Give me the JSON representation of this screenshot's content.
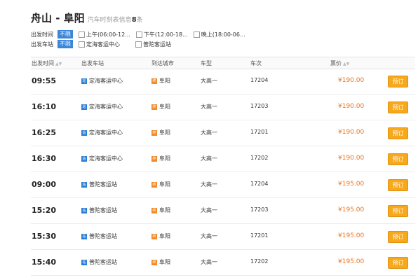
{
  "header": {
    "title": "舟山 - 阜阳",
    "subtitle_prefix": "汽车时刻表信息",
    "count": "8",
    "subtitle_suffix": "条"
  },
  "filters": {
    "time": {
      "label": "出发时间",
      "active": "不限",
      "options": [
        "上午(06:00-12...",
        "下午(12:00-18...",
        "晚上(18:00-06..."
      ]
    },
    "station": {
      "label": "出发车站",
      "active": "不限",
      "options": [
        "定海客运中心",
        "普陀客运站"
      ]
    }
  },
  "table": {
    "headers": [
      "出发时间",
      "出发车站",
      "到达城市",
      "车型",
      "车次",
      "票价"
    ],
    "book_label": "预订",
    "rows": [
      {
        "time": "09:55",
        "station": "定海客运中心",
        "dest": "阜阳",
        "bus": "大高一",
        "num": "17204",
        "price": "¥190.00"
      },
      {
        "time": "16:10",
        "station": "定海客运中心",
        "dest": "阜阳",
        "bus": "大高一",
        "num": "17203",
        "price": "¥190.00"
      },
      {
        "time": "16:25",
        "station": "定海客运中心",
        "dest": "阜阳",
        "bus": "大高一",
        "num": "17201",
        "price": "¥190.00"
      },
      {
        "time": "16:30",
        "station": "定海客运中心",
        "dest": "阜阳",
        "bus": "大高一",
        "num": "17202",
        "price": "¥190.00"
      },
      {
        "time": "09:00",
        "station": "普陀客运站",
        "dest": "阜阳",
        "bus": "大高一",
        "num": "17204",
        "price": "¥195.00"
      },
      {
        "time": "15:20",
        "station": "普陀客运站",
        "dest": "阜阳",
        "bus": "大高一",
        "num": "17203",
        "price": "¥195.00"
      },
      {
        "time": "15:30",
        "station": "普陀客运站",
        "dest": "阜阳",
        "bus": "大高一",
        "num": "17201",
        "price": "¥195.00"
      },
      {
        "time": "15:40",
        "station": "普陀客运站",
        "dest": "阜阳",
        "bus": "大高一",
        "num": "17202",
        "price": "¥195.00"
      }
    ]
  },
  "icons": {
    "from": "bus-station-icon",
    "to": "destination-icon"
  },
  "colors": {
    "accent": "#3a86d9",
    "price": "#e8731e",
    "book_button": "#f7a81b"
  }
}
